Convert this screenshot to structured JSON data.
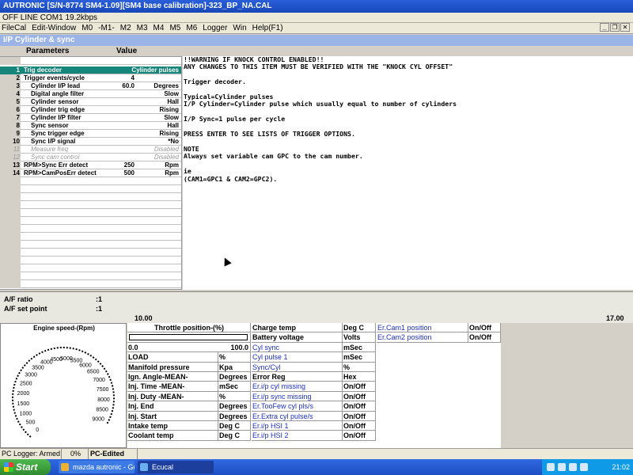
{
  "window": {
    "title": "AUTRONIC [S/N-8774 SM4-1.09][SM4 base calibration]-323_BP_NA.CAL",
    "status": "OFF LINE COM1 19.2kbps"
  },
  "menu": [
    {
      "label": "FileCal",
      "name": "menu-filecal"
    },
    {
      "label": "Edit-Window",
      "name": "menu-edit-window"
    },
    {
      "label": "M0",
      "name": "menu-m0"
    },
    {
      "label": "-M1-",
      "name": "menu-m1"
    },
    {
      "label": "M2",
      "name": "menu-m2"
    },
    {
      "label": "M3",
      "name": "menu-m3"
    },
    {
      "label": "M4",
      "name": "menu-m4"
    },
    {
      "label": "M5",
      "name": "menu-m5"
    },
    {
      "label": "M6",
      "name": "menu-m6"
    },
    {
      "label": "Logger",
      "name": "menu-logger"
    },
    {
      "label": "Win",
      "name": "menu-win"
    },
    {
      "label": "Help(F1)",
      "name": "menu-help"
    }
  ],
  "child": {
    "title": "I/P Cylinder & sync",
    "col_params": "Parameters",
    "col_value": "Value"
  },
  "params": [
    {
      "n": "1",
      "label": "Trig decoder",
      "value": "",
      "unit": "Cylinder pulses",
      "state": "sel"
    },
    {
      "n": "2",
      "label": "Trigger events/cycle",
      "value": "4",
      "unit": "",
      "state": ""
    },
    {
      "n": "3",
      "label": "Cylinder I/P lead",
      "value": "60.0",
      "unit": "Degrees",
      "state": "",
      "indent": true
    },
    {
      "n": "4",
      "label": "Digital angle filter",
      "value": "",
      "unit": "Slow",
      "state": "",
      "indent": true
    },
    {
      "n": "5",
      "label": "Cylinder sensor",
      "value": "",
      "unit": "Hall",
      "state": "",
      "indent": true
    },
    {
      "n": "6",
      "label": "Cylinder trig edge",
      "value": "",
      "unit": "Rising",
      "state": "",
      "indent": true
    },
    {
      "n": "7",
      "label": "Cylinder I/P filter",
      "value": "",
      "unit": "Slow",
      "state": "",
      "indent": true
    },
    {
      "n": "8",
      "label": "Sync sensor",
      "value": "",
      "unit": "Hall",
      "state": "",
      "indent": true
    },
    {
      "n": "9",
      "label": "Sync trigger edge",
      "value": "",
      "unit": "Rising",
      "state": "",
      "indent": true
    },
    {
      "n": "10",
      "label": "Sync I/P signal",
      "value": "",
      "unit": "*No",
      "state": "",
      "indent": true
    },
    {
      "n": "11",
      "label": "Measure freq",
      "value": "",
      "unit": "Disabled",
      "state": "dis",
      "indent": true
    },
    {
      "n": "12",
      "label": "Sync cam control",
      "value": "",
      "unit": "Disabled",
      "state": "dis",
      "indent": true
    },
    {
      "n": "13",
      "label": "RPM>Sync Err detect",
      "value": "250",
      "unit": "Rpm",
      "state": ""
    },
    {
      "n": "14",
      "label": "RPM>CamPosErr detect",
      "value": "500",
      "unit": "Rpm",
      "state": ""
    }
  ],
  "help_text": "!!WARNING IF KNOCK CONTROL ENABLED!!\nANY CHANGES TO THIS ITEM MUST BE VERIFIED WITH THE \"KNOCK CYL OFFSET\"\n\nTrigger decoder.\n\nTypical=Cylinder pulses\nI/P Cylinder=Cylinder pulse which usually equal to number of cylinders\n\nI/P Sync=1 pulse per cycle\n\nPRESS ENTER TO SEE LISTS OF TRIGGER OPTIONS.\n\nNOTE\nAlways set variable cam GPC to the cam number.\n\nie\n(CAM1=GPC1 & CAM2=GPC2).",
  "af": {
    "ratio_label": "A/F ratio",
    "ratio_value": ":1",
    "setpoint_label": "A/F set point",
    "setpoint_value": ":1",
    "scale_min": "10.00",
    "scale_max": "17.00"
  },
  "gauge": {
    "title": "Engine speed-(Rpm)",
    "ticks": [
      "0",
      "500",
      "1000",
      "1500",
      "2000",
      "2500",
      "3000",
      "3500",
      "4000",
      "4500",
      "5000",
      "5500",
      "6000",
      "6500",
      "7000",
      "7500",
      "8000",
      "8500",
      "9000"
    ],
    "value": 0
  },
  "throttle": {
    "label": "Throttle position-(%)",
    "min": "0.0",
    "max": "100.0",
    "fill": 0.0
  },
  "col1": [
    {
      "label": "LOAD",
      "unit": "%"
    },
    {
      "label": "Manifold pressure",
      "unit": "Kpa"
    },
    {
      "label": "Ign. Angle-MEAN-",
      "unit": "Degrees"
    },
    {
      "label": "Inj. Time -MEAN-",
      "unit": "mSec"
    },
    {
      "label": "Inj. Duty -MEAN-",
      "unit": "%"
    },
    {
      "label": "Inj. End",
      "unit": "Degrees"
    },
    {
      "label": "Inj. Start",
      "unit": "Degrees"
    },
    {
      "label": "Intake temp",
      "unit": "Deg C"
    },
    {
      "label": "Coolant temp",
      "unit": "Deg C"
    }
  ],
  "col2": [
    {
      "label": "Charge temp",
      "unit": "Deg C",
      "blue": false
    },
    {
      "label": "Battery voltage",
      "unit": "Volts",
      "blue": false
    },
    {
      "label": "Cyl sync",
      "unit": "mSec",
      "blue": true
    },
    {
      "label": "Cyl pulse 1",
      "unit": "mSec",
      "blue": true
    },
    {
      "label": "Sync/Cyl",
      "unit": "%",
      "blue": true
    },
    {
      "label": "Error Reg",
      "unit": "Hex",
      "blue": false
    },
    {
      "label": "Er.i/p cyl missing",
      "unit": "On/Off",
      "blue": true
    },
    {
      "label": "Er.i/p sync missing",
      "unit": "On/Off",
      "blue": true
    },
    {
      "label": "Er.TooFew cyl pls/s",
      "unit": "On/Off",
      "blue": true
    },
    {
      "label": "Er.Extra cyl pulse/s",
      "unit": "On/Off",
      "blue": true
    },
    {
      "label": "Er.i/p HSI 1",
      "unit": "On/Off",
      "blue": true
    },
    {
      "label": "Er.i/p HSI 2",
      "unit": "On/Off",
      "blue": true
    }
  ],
  "col3": [
    {
      "label": "Er.Cam1 position",
      "unit": "On/Off"
    },
    {
      "label": "Er.Cam2 position",
      "unit": "On/Off"
    }
  ],
  "bottom_status": {
    "logger": "PC Logger: Armed",
    "pct": "0%",
    "edited": "PC-Edited"
  },
  "taskbar": {
    "start": "Start",
    "tasks": [
      {
        "label": "mazda autronic - Goo..."
      },
      {
        "label": "Ecucal"
      }
    ],
    "clock": "21:02"
  }
}
